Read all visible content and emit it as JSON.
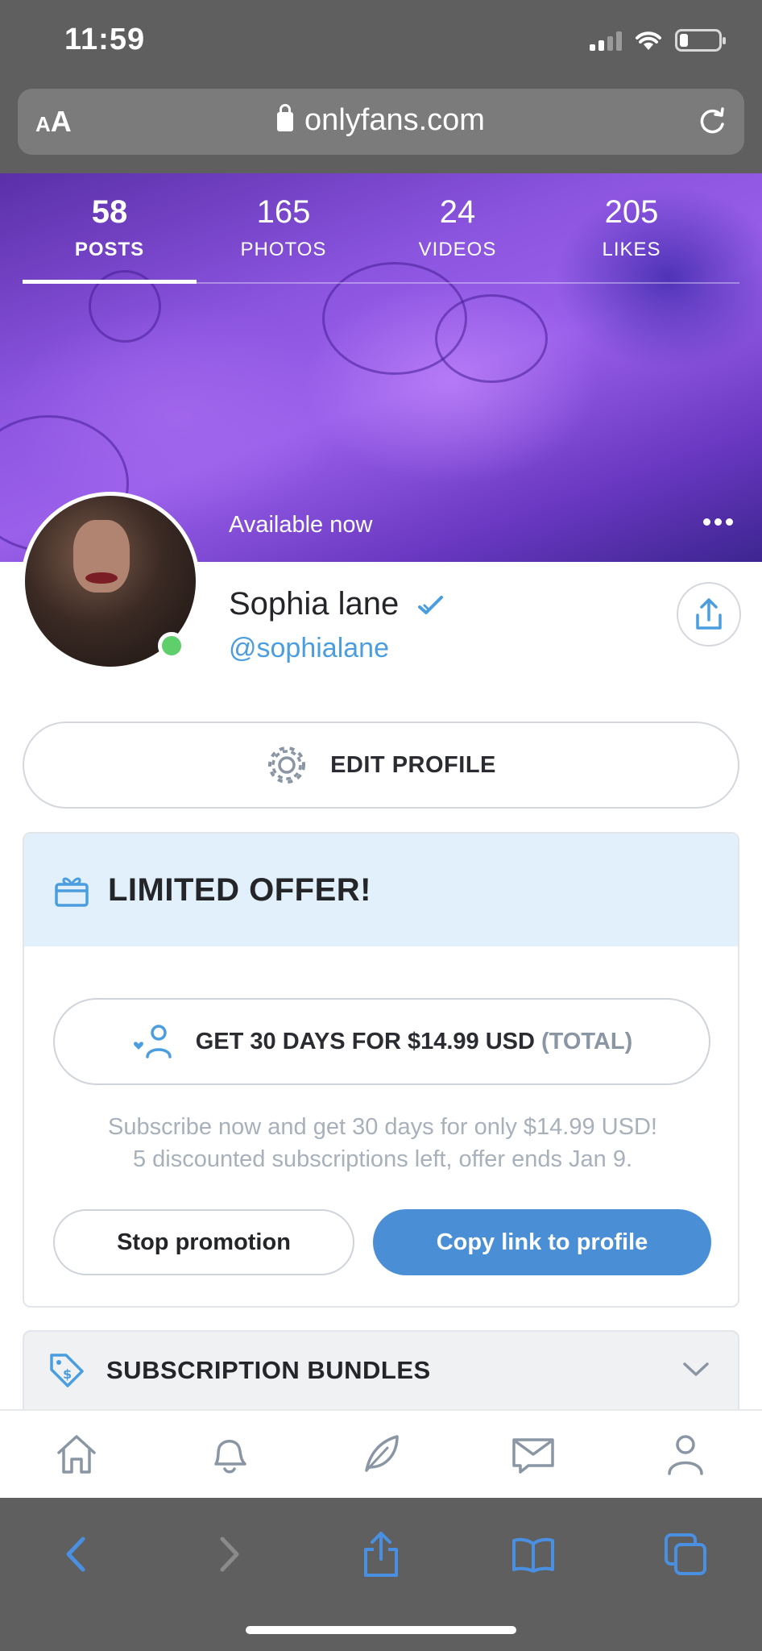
{
  "status_bar": {
    "time": "11:59"
  },
  "browser": {
    "text_size_label_small": "A",
    "text_size_label_big": "A",
    "url": "onlyfans.com"
  },
  "profile": {
    "stats": [
      {
        "value": "58",
        "label": "POSTS"
      },
      {
        "value": "165",
        "label": "PHOTOS"
      },
      {
        "value": "24",
        "label": "VIDEOS"
      },
      {
        "value": "205",
        "label": "LIKES"
      }
    ],
    "availability": "Available now",
    "name": "Sophia lane",
    "handle": "@sophialane",
    "edit_label": "EDIT PROFILE"
  },
  "offer": {
    "title": "LIMITED OFFER!",
    "button_main": "GET 30 DAYS FOR $14.99 USD",
    "button_muted": "(TOTAL)",
    "desc_line1": "Subscribe now and get 30 days for only $14.99 USD!",
    "desc_line2": "5 discounted subscriptions left, offer ends Jan 9.",
    "stop_label": "Stop promotion",
    "copy_label": "Copy link to profile"
  },
  "bundles": {
    "title": "SUBSCRIPTION BUNDLES"
  },
  "colors": {
    "accent": "#4a8fd6",
    "handle": "#4a9ee0",
    "online": "#5fcf6b",
    "offer_bg": "#e1f0fa"
  }
}
